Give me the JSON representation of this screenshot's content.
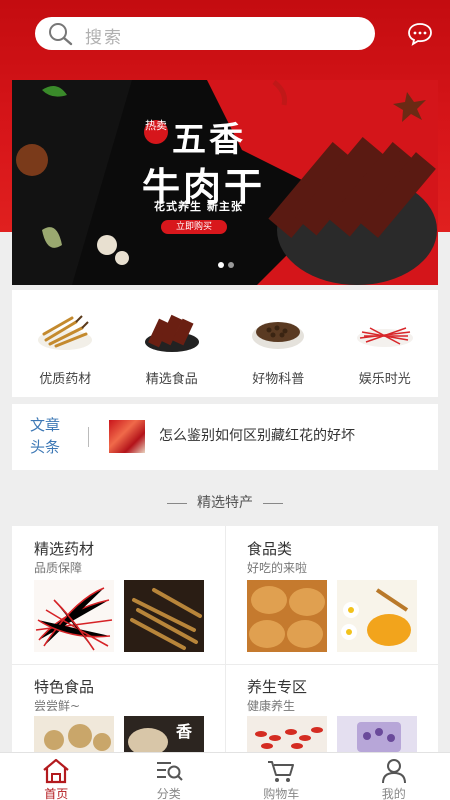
{
  "search": {
    "placeholder": "搜索"
  },
  "banner": {
    "badge": "热卖",
    "title_line1": "五香",
    "title_line2": "牛肉干",
    "subtitle": "花式养生  新主张",
    "cta": "立即购买",
    "slide_count": 2,
    "active_slide": 1
  },
  "categories": [
    {
      "label": "优质药材",
      "icon": "cordyceps-icon"
    },
    {
      "label": "精选食品",
      "icon": "jerky-icon"
    },
    {
      "label": "好物科普",
      "icon": "tea-bowl-icon"
    },
    {
      "label": "娱乐时光",
      "icon": "saffron-icon"
    }
  ],
  "news": {
    "heading": "文章头条",
    "heading_line1": "文章",
    "heading_line2": "头条",
    "headline": "怎么鉴别如何区别藏红花的好坏"
  },
  "section": {
    "title": "精选特产"
  },
  "featured": [
    {
      "title": "精选药材",
      "subtitle": "品质保障"
    },
    {
      "title": "食品类",
      "subtitle": "好吃的来啦"
    },
    {
      "title": "特色食品",
      "subtitle": "尝尝鲜~"
    },
    {
      "title": "养生专区",
      "subtitle": "健康养生"
    }
  ],
  "featured_image_text": "香",
  "tabs": [
    {
      "label": "首页",
      "icon": "home-icon",
      "active": true
    },
    {
      "label": "分类",
      "icon": "category-icon",
      "active": false
    },
    {
      "label": "购物车",
      "icon": "cart-icon",
      "active": false
    },
    {
      "label": "我的",
      "icon": "user-icon",
      "active": false
    }
  ],
  "colors": {
    "brand_red": "#d8161a",
    "active_tab": "#b31a1e",
    "news_heading": "#3d78b5"
  }
}
